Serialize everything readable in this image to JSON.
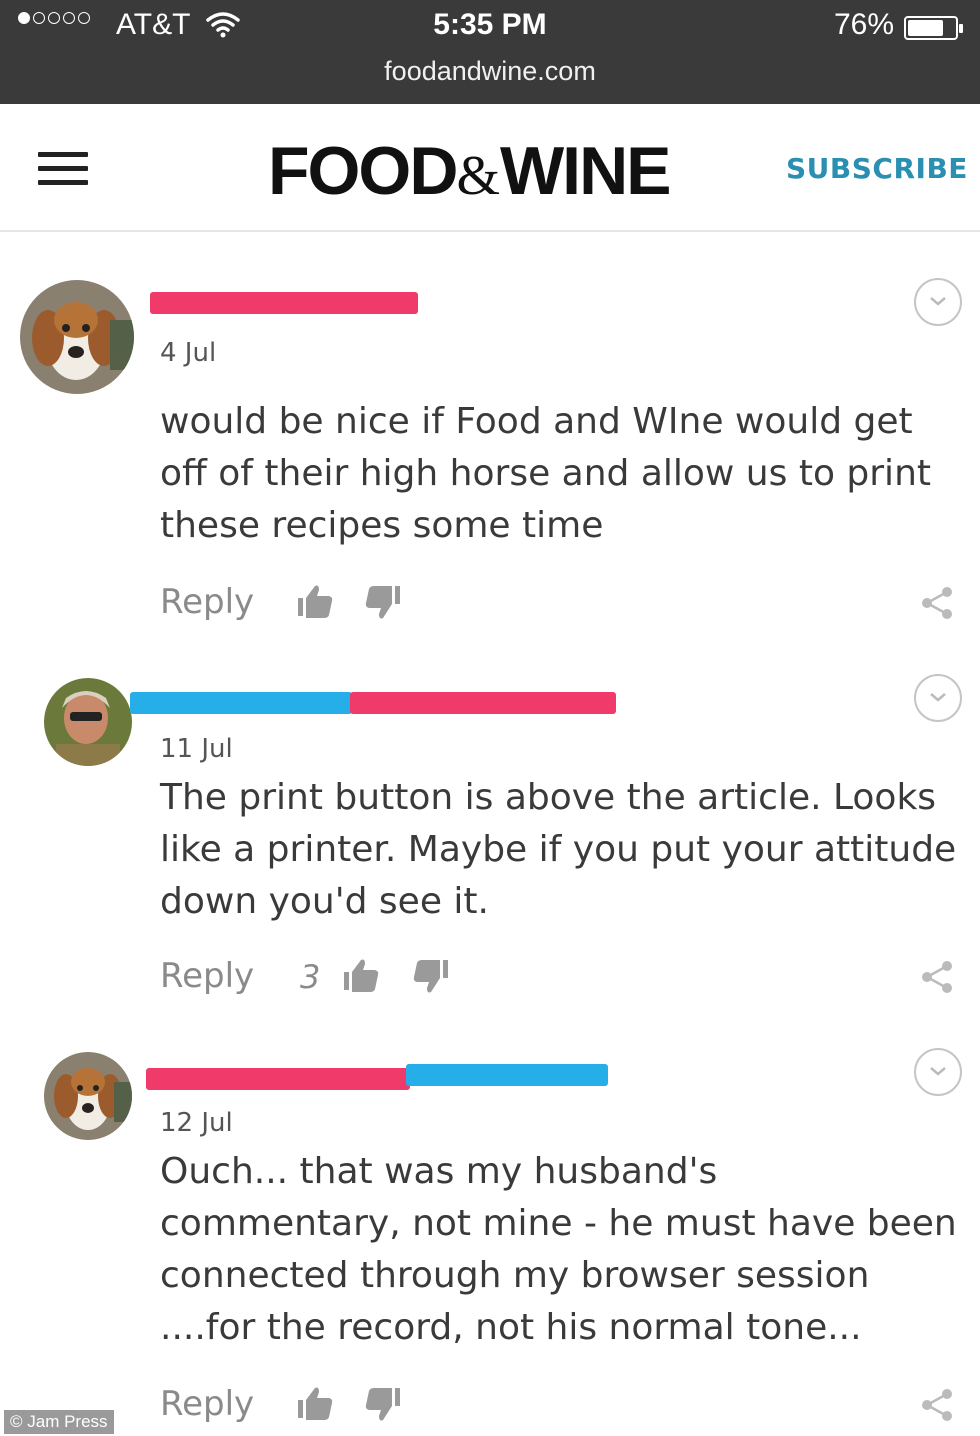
{
  "status_bar": {
    "carrier": "AT&T",
    "time": "5:35 PM",
    "battery": "76%",
    "battery_level": 0.76,
    "url": "foodandwine.com"
  },
  "header": {
    "logo_left": "FOOD",
    "logo_amp": "&",
    "logo_right": "WINE",
    "subscribe": "SUBSCRIBE"
  },
  "comments": [
    {
      "date": "4 Jul",
      "text": "would be nice if Food and WIne would get off of their high horse and allow us to print these recipes some time",
      "reply": "Reply",
      "likes": ""
    },
    {
      "date": "11 Jul",
      "text": "The print button is above the article. Looks like a printer. Maybe if you put your attitude down you'd see it.",
      "reply": "Reply",
      "likes": "3"
    },
    {
      "date": "12 Jul",
      "text": "Ouch... that was my husband's commentary, not mine - he must have been connected through my browser session ....for the record, not his normal tone...",
      "reply": "Reply",
      "likes": ""
    }
  ],
  "watermark": "© Jam Press",
  "colors": {
    "redaction_pink": "#ef3a6a",
    "redaction_blue": "#25aee8",
    "subscribe": "#2a8fb0",
    "status_bar": "#3a3a3a"
  }
}
